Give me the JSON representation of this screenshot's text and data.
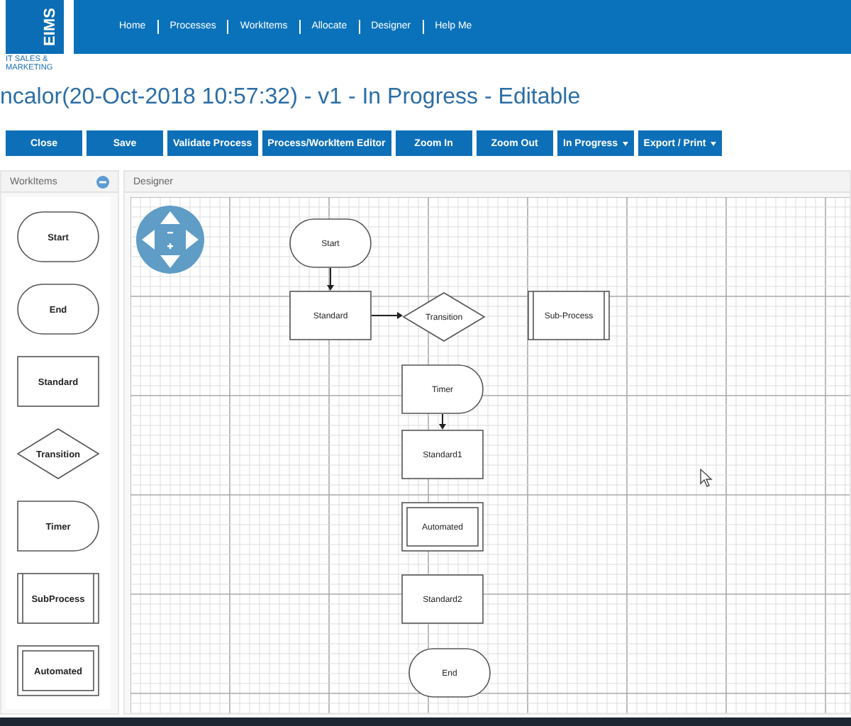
{
  "logo": {
    "text": "EIMS",
    "tagline": "IT SALES & MARKETING"
  },
  "nav": [
    "Home",
    "Processes",
    "WorkItems",
    "Allocate",
    "Designer",
    "Help Me"
  ],
  "title": "ncalor(20-Oct-2018 10:57:32) - v1 - In Progress - Editable",
  "toolbar": [
    {
      "label": "Close",
      "kind": "button"
    },
    {
      "label": "Save",
      "kind": "button"
    },
    {
      "label": "Validate Process",
      "kind": "button"
    },
    {
      "label": "Process/WorkItem Editor",
      "kind": "button"
    },
    {
      "label": "Zoom In",
      "kind": "button"
    },
    {
      "label": "Zoom Out",
      "kind": "button"
    },
    {
      "label": "In Progress",
      "kind": "dropdown"
    },
    {
      "label": "Export / Print",
      "kind": "dropdown"
    }
  ],
  "workitems": {
    "title": "WorkItems",
    "items": [
      {
        "label": "Start",
        "kind": "terminal"
      },
      {
        "label": "End",
        "kind": "terminal"
      },
      {
        "label": "Standard",
        "kind": "process"
      },
      {
        "label": "Transition",
        "kind": "decision"
      },
      {
        "label": "Timer",
        "kind": "delay"
      },
      {
        "label": "SubProcess",
        "kind": "subprocess"
      },
      {
        "label": "Automated",
        "kind": "automated"
      }
    ]
  },
  "designer": {
    "title": "Designer",
    "nodes": [
      {
        "label": "Start",
        "kind": "terminal",
        "arrow_down": true,
        "arrow_right": false
      },
      {
        "label": "Standard",
        "kind": "process",
        "arrow_down": false,
        "arrow_right": true
      },
      {
        "label": "Transition",
        "kind": "decision",
        "arrow_down": false,
        "arrow_right": false
      },
      {
        "label": "Sub-Process",
        "kind": "subprocess",
        "arrow_down": false,
        "arrow_right": false
      },
      {
        "label": "Timer",
        "kind": "delay",
        "arrow_down": true,
        "arrow_right": false
      },
      {
        "label": "Standard1",
        "kind": "process",
        "arrow_down": false,
        "arrow_right": false
      },
      {
        "label": "Automated",
        "kind": "automated",
        "arrow_down": false,
        "arrow_right": false
      },
      {
        "label": "Standard2",
        "kind": "process",
        "arrow_down": false,
        "arrow_right": false
      },
      {
        "label": "End",
        "kind": "terminal",
        "arrow_down": false,
        "arrow_right": false
      }
    ]
  }
}
